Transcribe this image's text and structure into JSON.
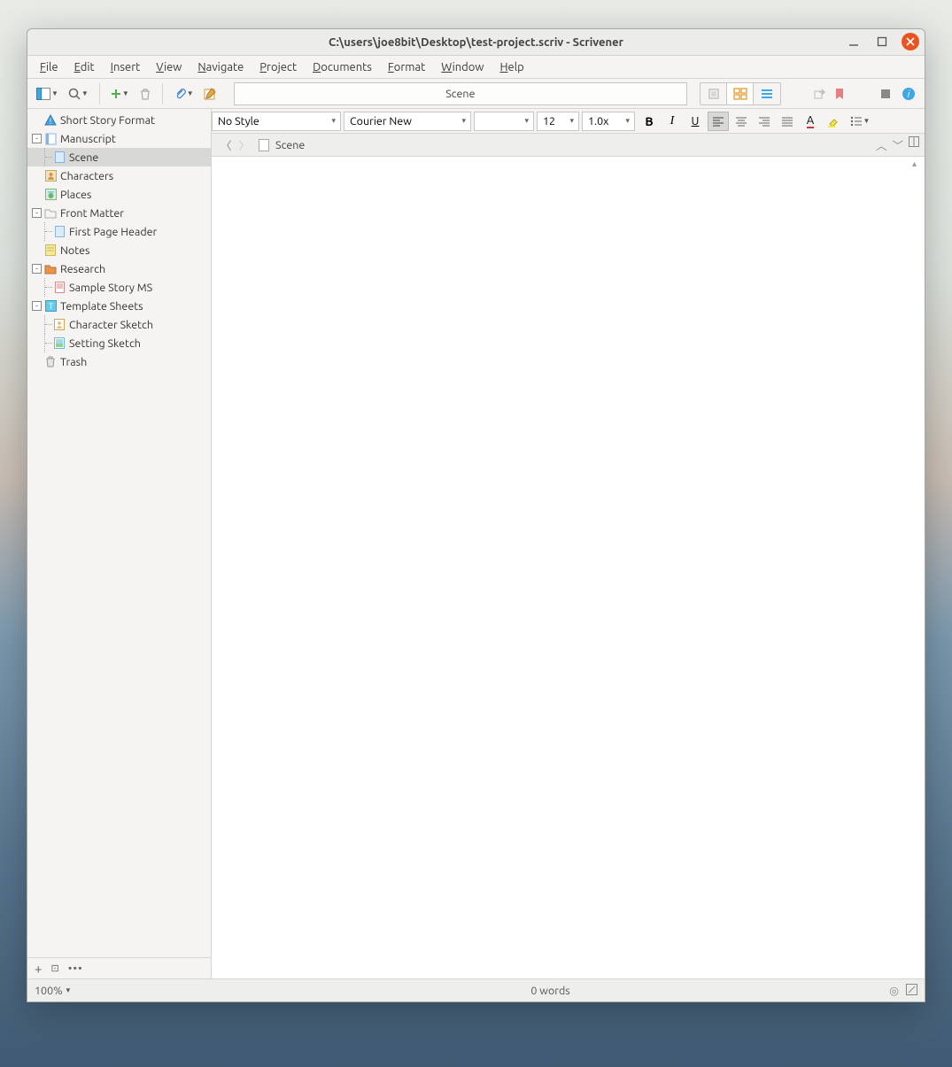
{
  "title": "C:\\users\\joe8bit\\Desktop\\test-project.scriv - Scrivener",
  "menu": [
    "File",
    "Edit",
    "Insert",
    "View",
    "Navigate",
    "Project",
    "Documents",
    "Format",
    "Window",
    "Help"
  ],
  "toolbar_center": "Scene",
  "format": {
    "style": "No Style",
    "font": "Courier New",
    "size": "12",
    "spacing": "1.0x"
  },
  "binder": [
    {
      "label": "Short Story Format",
      "icon": "triangle",
      "level": 0,
      "exp": null
    },
    {
      "label": "Manuscript",
      "icon": "book",
      "level": 0,
      "exp": "-"
    },
    {
      "label": "Scene",
      "icon": "page",
      "level": 1,
      "exp": null,
      "sel": true
    },
    {
      "label": "Characters",
      "icon": "chars",
      "level": 0,
      "exp": null
    },
    {
      "label": "Places",
      "icon": "places",
      "level": 0,
      "exp": null
    },
    {
      "label": "Front Matter",
      "icon": "folder",
      "level": 0,
      "exp": "-"
    },
    {
      "label": "First Page Header",
      "icon": "page",
      "level": 1,
      "exp": null
    },
    {
      "label": "Notes",
      "icon": "note",
      "level": 0,
      "exp": null
    },
    {
      "label": "Research",
      "icon": "research",
      "level": 0,
      "exp": "-"
    },
    {
      "label": "Sample Story MS",
      "icon": "doc",
      "level": 1,
      "exp": null
    },
    {
      "label": "Template Sheets",
      "icon": "tpl",
      "level": 0,
      "exp": "-"
    },
    {
      "label": "Character Sketch",
      "icon": "sketch",
      "level": 1,
      "exp": null
    },
    {
      "label": "Setting Sketch",
      "icon": "sketch2",
      "level": 1,
      "exp": null
    },
    {
      "label": "Trash",
      "icon": "trash",
      "level": 0,
      "exp": null
    }
  ],
  "doc_header": "Scene",
  "footer": {
    "zoom": "100%",
    "words": "0 words"
  }
}
